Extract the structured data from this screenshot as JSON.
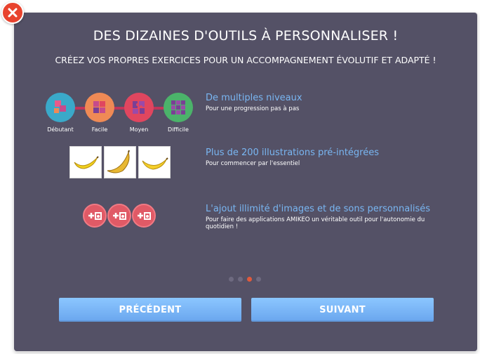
{
  "dialog": {
    "title": "DES DIZAINES D'OUTILS À PERSONNALISER !",
    "subtitle": "CRÉEZ VOS PROPRES EXERCICES POUR UN ACCOMPAGNEMENT ÉVOLUTIF ET ADAPTÉ !",
    "close_icon": "close-icon"
  },
  "features": [
    {
      "title": "De multiples niveaux",
      "description": "Pour une progression pas à pas",
      "levels": [
        {
          "label": "Débutant",
          "color": "#3aa9c9"
        },
        {
          "label": "Facile",
          "color": "#ef8a55"
        },
        {
          "label": "Moyen",
          "color": "#e0465f"
        },
        {
          "label": "Difficile",
          "color": "#4bb36a"
        }
      ]
    },
    {
      "title": "Plus de 200 illustrations pré-intégrées",
      "description": "Pour commencer par l'essentiel",
      "images": [
        "banana-image",
        "banana-image",
        "banana-image"
      ]
    },
    {
      "title": "L'ajout illimité d'images et de sons personnalisés",
      "description": "Pour faire des applications AMIKEO un véritable outil pour l'autonomie du quotidien !",
      "media_icons": [
        "add-media-icon",
        "add-media-icon",
        "add-media-icon"
      ]
    }
  ],
  "pagination": {
    "total": 4,
    "current": 3,
    "active_color": "#e05a3c"
  },
  "buttons": {
    "previous": "PRÉCÉDENT",
    "next": "SUIVANT"
  }
}
